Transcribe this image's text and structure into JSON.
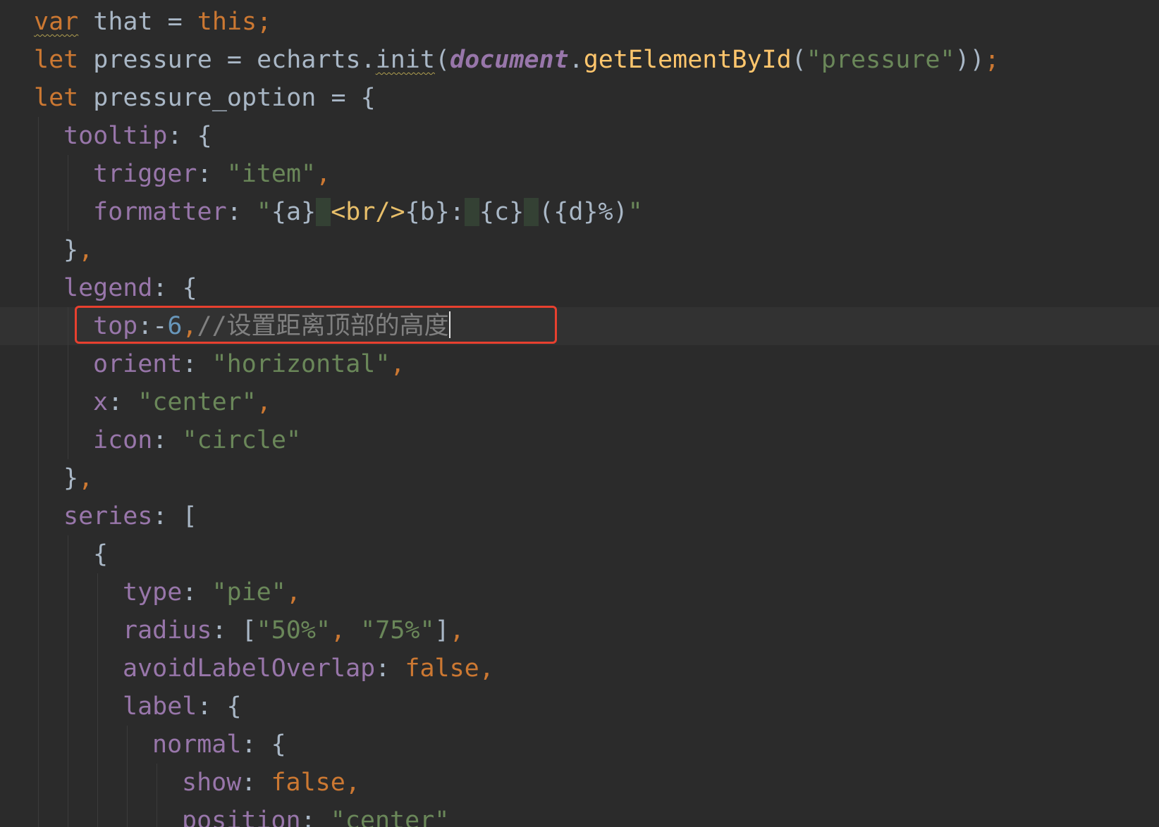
{
  "code": {
    "lines": [
      {
        "indent": 1,
        "tokens": [
          {
            "t": "var",
            "c": "kw wavy"
          },
          {
            "t": " that = ",
            "c": "plain"
          },
          {
            "t": "this",
            "c": "kw"
          },
          {
            "t": ";",
            "c": "punc"
          }
        ]
      },
      {
        "indent": 1,
        "tokens": [
          {
            "t": "let",
            "c": "kw"
          },
          {
            "t": " pressure = echarts.",
            "c": "plain"
          },
          {
            "t": "init",
            "c": "plain wavy"
          },
          {
            "t": "(",
            "c": "plain"
          },
          {
            "t": "document",
            "c": "glob"
          },
          {
            "t": ".",
            "c": "plain"
          },
          {
            "t": "getElementById",
            "c": "fn"
          },
          {
            "t": "(",
            "c": "plain"
          },
          {
            "t": "\"pressure\"",
            "c": "str"
          },
          {
            "t": "))",
            "c": "plain"
          },
          {
            "t": ";",
            "c": "punc"
          }
        ]
      },
      {
        "indent": 1,
        "tokens": [
          {
            "t": "let",
            "c": "kw"
          },
          {
            "t": " pressure_option = {",
            "c": "plain"
          }
        ]
      },
      {
        "indent": 2,
        "tokens": [
          {
            "t": "tooltip",
            "c": "prop"
          },
          {
            "t": ": {",
            "c": "plain"
          }
        ]
      },
      {
        "indent": 3,
        "tokens": [
          {
            "t": "trigger",
            "c": "prop"
          },
          {
            "t": ": ",
            "c": "plain"
          },
          {
            "t": "\"item\"",
            "c": "str"
          },
          {
            "t": ",",
            "c": "punc"
          }
        ]
      },
      {
        "indent": 3,
        "tokens": [
          {
            "t": "formatter",
            "c": "prop"
          },
          {
            "t": ": ",
            "c": "plain"
          },
          {
            "t": "\"",
            "c": "str"
          },
          {
            "t": "{a}",
            "c": "plain"
          },
          {
            "t": " ",
            "c": "sp-hl"
          },
          {
            "t": "<br/>",
            "c": "tag"
          },
          {
            "t": "{b}:",
            "c": "plain"
          },
          {
            "t": " ",
            "c": "sp-hl"
          },
          {
            "t": "{c}",
            "c": "plain"
          },
          {
            "t": " ",
            "c": "sp-hl"
          },
          {
            "t": "({d}%)",
            "c": "plain"
          },
          {
            "t": "\"",
            "c": "str"
          }
        ]
      },
      {
        "indent": 2,
        "tokens": [
          {
            "t": "}",
            "c": "plain"
          },
          {
            "t": ",",
            "c": "punc"
          }
        ]
      },
      {
        "indent": 2,
        "tokens": [
          {
            "t": "legend",
            "c": "prop"
          },
          {
            "t": ": {",
            "c": "plain"
          }
        ]
      },
      {
        "indent": 3,
        "current": true,
        "tokens": [
          {
            "t": "top",
            "c": "prop"
          },
          {
            "t": ":-",
            "c": "plain"
          },
          {
            "t": "6",
            "c": "num"
          },
          {
            "t": ",",
            "c": "punc"
          },
          {
            "t": "//设置距离顶部的高度",
            "c": "cmt"
          }
        ]
      },
      {
        "indent": 3,
        "tokens": [
          {
            "t": "orient",
            "c": "prop"
          },
          {
            "t": ": ",
            "c": "plain"
          },
          {
            "t": "\"horizontal\"",
            "c": "str"
          },
          {
            "t": ",",
            "c": "punc"
          }
        ]
      },
      {
        "indent": 3,
        "tokens": [
          {
            "t": "x",
            "c": "prop"
          },
          {
            "t": ": ",
            "c": "plain"
          },
          {
            "t": "\"center\"",
            "c": "str"
          },
          {
            "t": ",",
            "c": "punc"
          }
        ]
      },
      {
        "indent": 3,
        "tokens": [
          {
            "t": "icon",
            "c": "prop"
          },
          {
            "t": ": ",
            "c": "plain"
          },
          {
            "t": "\"circle\"",
            "c": "str"
          }
        ]
      },
      {
        "indent": 2,
        "tokens": [
          {
            "t": "}",
            "c": "plain"
          },
          {
            "t": ",",
            "c": "punc"
          }
        ]
      },
      {
        "indent": 2,
        "tokens": [
          {
            "t": "series",
            "c": "prop"
          },
          {
            "t": ": [",
            "c": "plain"
          }
        ]
      },
      {
        "indent": 3,
        "tokens": [
          {
            "t": "{",
            "c": "plain"
          }
        ]
      },
      {
        "indent": 4,
        "tokens": [
          {
            "t": "type",
            "c": "prop"
          },
          {
            "t": ": ",
            "c": "plain"
          },
          {
            "t": "\"pie\"",
            "c": "str"
          },
          {
            "t": ",",
            "c": "punc"
          }
        ]
      },
      {
        "indent": 4,
        "tokens": [
          {
            "t": "radius",
            "c": "prop"
          },
          {
            "t": ": [",
            "c": "plain"
          },
          {
            "t": "\"50%\"",
            "c": "str"
          },
          {
            "t": ", ",
            "c": "punc"
          },
          {
            "t": "\"75%\"",
            "c": "str"
          },
          {
            "t": "]",
            "c": "plain"
          },
          {
            "t": ",",
            "c": "punc"
          }
        ]
      },
      {
        "indent": 4,
        "tokens": [
          {
            "t": "avoidLabelOverlap",
            "c": "prop"
          },
          {
            "t": ": ",
            "c": "plain"
          },
          {
            "t": "false",
            "c": "kw"
          },
          {
            "t": ",",
            "c": "punc"
          }
        ]
      },
      {
        "indent": 4,
        "tokens": [
          {
            "t": "label",
            "c": "prop"
          },
          {
            "t": ": {",
            "c": "plain"
          }
        ]
      },
      {
        "indent": 5,
        "tokens": [
          {
            "t": "normal",
            "c": "prop"
          },
          {
            "t": ": {",
            "c": "plain"
          }
        ]
      },
      {
        "indent": 6,
        "tokens": [
          {
            "t": "show",
            "c": "prop"
          },
          {
            "t": ": ",
            "c": "plain"
          },
          {
            "t": "false",
            "c": "kw"
          },
          {
            "t": ",",
            "c": "punc"
          }
        ]
      },
      {
        "indent": 6,
        "tokens": [
          {
            "t": "position",
            "c": "prop"
          },
          {
            "t": ": ",
            "c": "plain"
          },
          {
            "t": "\"center\"",
            "c": "str"
          }
        ]
      }
    ]
  },
  "colors": {
    "background": "#2b2b2b",
    "highlight_box": "#e8402f"
  }
}
